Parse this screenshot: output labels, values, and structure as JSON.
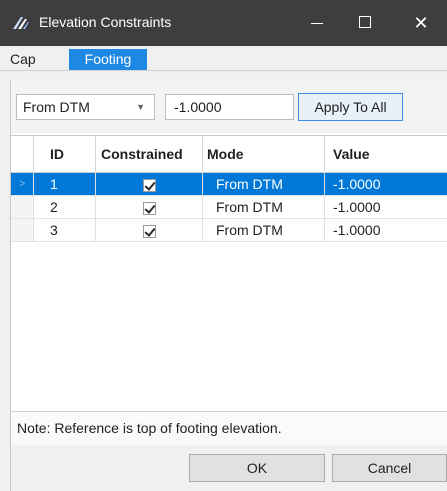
{
  "window": {
    "title": "Elevation Constraints",
    "close_glyph": "✕"
  },
  "tabs": [
    {
      "label": "Cap",
      "selected": false
    },
    {
      "label": "Footing",
      "selected": true
    }
  ],
  "toolbar": {
    "mode_select_value": "From DTM",
    "value_input": "-1.0000",
    "apply_label": "Apply To All"
  },
  "grid": {
    "columns": [
      "ID",
      "Constrained",
      "Mode",
      "Value"
    ],
    "rows": [
      {
        "id": "1",
        "constrained": true,
        "mode": "From DTM",
        "value": "-1.0000",
        "selected": true
      },
      {
        "id": "2",
        "constrained": true,
        "mode": "From DTM",
        "value": "-1.0000",
        "selected": false
      },
      {
        "id": "3",
        "constrained": true,
        "mode": "From DTM",
        "value": "-1.0000",
        "selected": false
      }
    ]
  },
  "note": "Note: Reference is top of footing elevation.",
  "footer": {
    "ok_label": "OK",
    "cancel_label": "Cancel"
  },
  "colors": {
    "titlebar": "#3e3e3e",
    "accent": "#1e88e5",
    "selection": "#0078d7"
  }
}
